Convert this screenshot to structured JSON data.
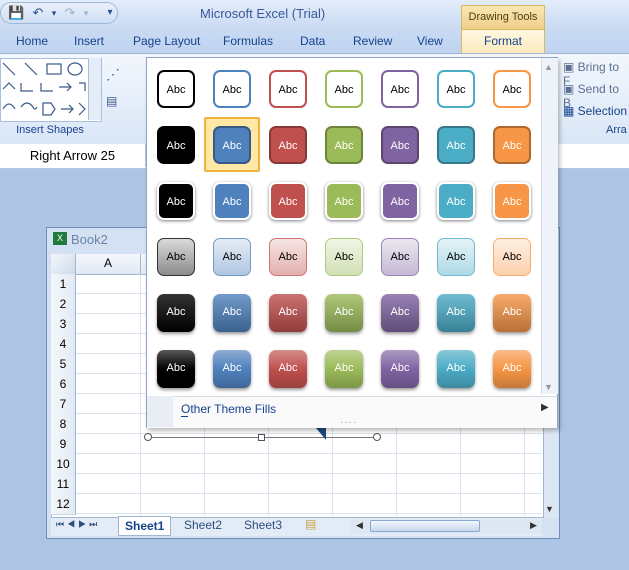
{
  "app": {
    "title": "Microsoft Excel (Trial)",
    "context_tab_group": "Drawing Tools"
  },
  "tabs": [
    "Home",
    "Insert",
    "Page Layout",
    "Formulas",
    "Data",
    "Review",
    "View",
    "Format"
  ],
  "active_tab": "Format",
  "ribbon": {
    "insert_shapes_label": "Insert Shapes",
    "arrange": {
      "bring_to_front": "Bring to F",
      "send_to_back": "Send to B",
      "selection_pane": "Selection",
      "group_label": "Arra"
    }
  },
  "name_box": "Right Arrow 25",
  "workbook": {
    "title": "Book2",
    "column_header": "A",
    "rows": [
      "1",
      "2",
      "3",
      "4",
      "5",
      "6",
      "7",
      "8",
      "9",
      "10",
      "11",
      "12"
    ],
    "sheets": [
      "Sheet1",
      "Sheet2",
      "Sheet3"
    ],
    "active_sheet": "Sheet1"
  },
  "gallery": {
    "swatch_label": "Abc",
    "theme_colors": [
      "#000000",
      "#4f81bd",
      "#c0504d",
      "#9bbb59",
      "#8064a2",
      "#4bacc6",
      "#f79646"
    ],
    "selected": {
      "row": 2,
      "col": 2
    },
    "other_fills": "Other Theme Fills"
  }
}
